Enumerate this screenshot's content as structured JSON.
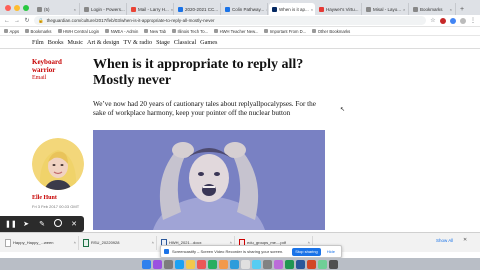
{
  "browser": {
    "tabs": [
      {
        "label": "(5)",
        "fav": "",
        "active": false
      },
      {
        "label": "Login - Powers...",
        "fav": "",
        "active": false
      },
      {
        "label": "Mail - Larry H...",
        "fav": "m",
        "active": false
      },
      {
        "label": "2020-2021 CC...",
        "fav": "c",
        "active": false
      },
      {
        "label": "Colin Pathway...",
        "fav": "c",
        "active": false
      },
      {
        "label": "When is it ap...",
        "fav": "g",
        "active": true
      },
      {
        "label": "Haywer's Virtu...",
        "fav": "t",
        "active": false
      },
      {
        "label": "Misal - Layo...",
        "fav": "",
        "active": false
      },
      {
        "label": "Bookmarks",
        "fav": "",
        "active": false
      }
    ],
    "new_tab_glyph": "+",
    "url": "theguardian.com/culture/2017/feb/03/when-is-it-appropriate-to-reply-all-mostly-never",
    "bookmarks": [
      "Apps",
      "Bookmarks",
      "HWH Central Login",
      "NWEA - Admin",
      "New Tab",
      "Illinois Tech To...",
      "HWH Teacher New...",
      "Important From D...",
      "Other Bookmarks"
    ]
  },
  "guardian": {
    "nav": [
      "Film",
      "Books",
      "Music",
      "Art & design",
      "TV & radio",
      "Stage",
      "Classical",
      "Games"
    ]
  },
  "article": {
    "kicker": "Keyboard warrior",
    "kicker_sub": "Email",
    "headline": "When is it appropriate to reply all? Mostly never",
    "standfirst": "We’ve now had 20 years of cautionary tales about replyallpocalypses. For the sake of workplace harmony, keep your pointer off the nuclear button",
    "byline": "Elle Hunt",
    "date": "Fri 3 Feb 2017 00.03 GMT"
  },
  "annotation_toolbar": {
    "tools": [
      "pause-icon",
      "pointer-icon",
      "pen-icon",
      "eraser-icon",
      "close-icon"
    ]
  },
  "downloads": {
    "items": [
      {
        "name": "Happy_Happy_...ween",
        "type": "file"
      },
      {
        "name": "RSU_20220928",
        "type": "x"
      },
      {
        "name": "HWH_2021...docx",
        "type": "w"
      },
      {
        "name": "edu_groups_me....pdf",
        "type": "p"
      }
    ],
    "show_all": "Show All",
    "share_bar": {
      "text": "Screencastify – Screen Video Recorder is sharing your screen.",
      "stop_label": "Stop sharing",
      "hide_label": "Hide"
    }
  },
  "colors": {
    "guardian_red": "#c70000",
    "guardian_blue": "#052962",
    "chrome_blue": "#1a73e8",
    "hero_tint": "#7e86c6"
  }
}
